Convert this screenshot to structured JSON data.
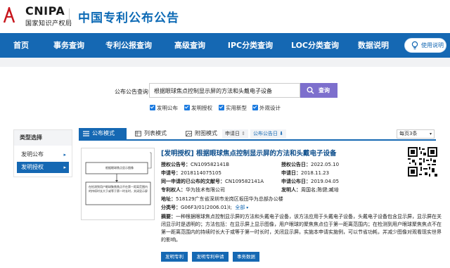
{
  "header": {
    "logo_en": "CNIPA",
    "logo_cn": "国家知识产权局",
    "site_title": "中国专利公布公告"
  },
  "nav": {
    "items": [
      "首页",
      "事务查询",
      "专利公报查询",
      "高级查询",
      "IPC分类查询",
      "LOC分类查询",
      "数据说明"
    ],
    "help_label": "使用说明"
  },
  "search": {
    "label": "公布公告查询",
    "value": "根据眼球焦点控制显示屏的方法和头戴电子设备",
    "button_label": "查询",
    "checkboxes": [
      {
        "label": "发明公布",
        "checked": true
      },
      {
        "label": "发明授权",
        "checked": true
      },
      {
        "label": "实用新型",
        "checked": true
      },
      {
        "label": "外观设计",
        "checked": true
      }
    ]
  },
  "sidebar": {
    "title": "类型选择",
    "items": [
      {
        "label": "发明公布",
        "active": false
      },
      {
        "label": "发明授权",
        "active": true
      }
    ]
  },
  "toolbar": {
    "tabs": [
      "公布模式",
      "列表模式",
      "附图模式"
    ],
    "sort_apply": "申请日",
    "sort_pub": "公布公告日",
    "per_page": "每页3条"
  },
  "result": {
    "title": "[发明授权] 根据眼球焦点控制显示屏的方法和头戴电子设备",
    "grant_no_label": "授权公告号：",
    "grant_no": "CN109582141B",
    "grant_date_label": "授权公告日：",
    "grant_date": "2022.05.10",
    "app_no_label": "申请号：",
    "app_no": "2018114075105",
    "app_date_label": "申请日：",
    "app_date": "2018.11.23",
    "same_app_label": "同一申请的已公布的文献号：",
    "same_app": "CN109582141A",
    "same_pub_label": "申请公布日：",
    "same_pub": "2019.04.05",
    "patentee_label": "专利权人：",
    "patentee": "华为技术有限公司",
    "inventor_label": "发明人：",
    "inventor": "周国名;陈健;臧培",
    "address_label": "地址：",
    "address": "518129广东省深圳市龙岗区坂田华为总部办公楼",
    "class_label": "分类号：",
    "class_value": "G06F3/01(2006.01)I;",
    "class_more": "全部",
    "abstract_label": "摘要：",
    "abstract": "一种根据眼球焦点控制显示屏的方法和头戴电子设备，该方法应用于头戴电子设备，头戴电子设备包含显示屏，显示屏在关闭显示时是透明的；方法包括：在显示屏上显示图像，用户眼球的聚焦焦点位于第一距离范围内；在检测到用户眼球聚焦焦点不在第一距离范围内的持续时长大于或等于第一时长时，关闭显示屏。实施本申请实施例，可以节省功耗，并减少图像对观看现实世界的影响。",
    "buttons": [
      "发明专利",
      "发明专利申请",
      "事务数据"
    ],
    "thumb_box1": "根据眼球焦点显示图像",
    "thumb_box2": "在检测到用户眼球聚焦焦点不在第一距离范围内的持续时长大于或等于第一时长时，关闭显示屏"
  },
  "colors": {
    "nav_bg": "#1568b3",
    "search_button": "#7d6fcd",
    "title_blue": "#0d6ab5",
    "checkbox": "#1a7ae0"
  }
}
